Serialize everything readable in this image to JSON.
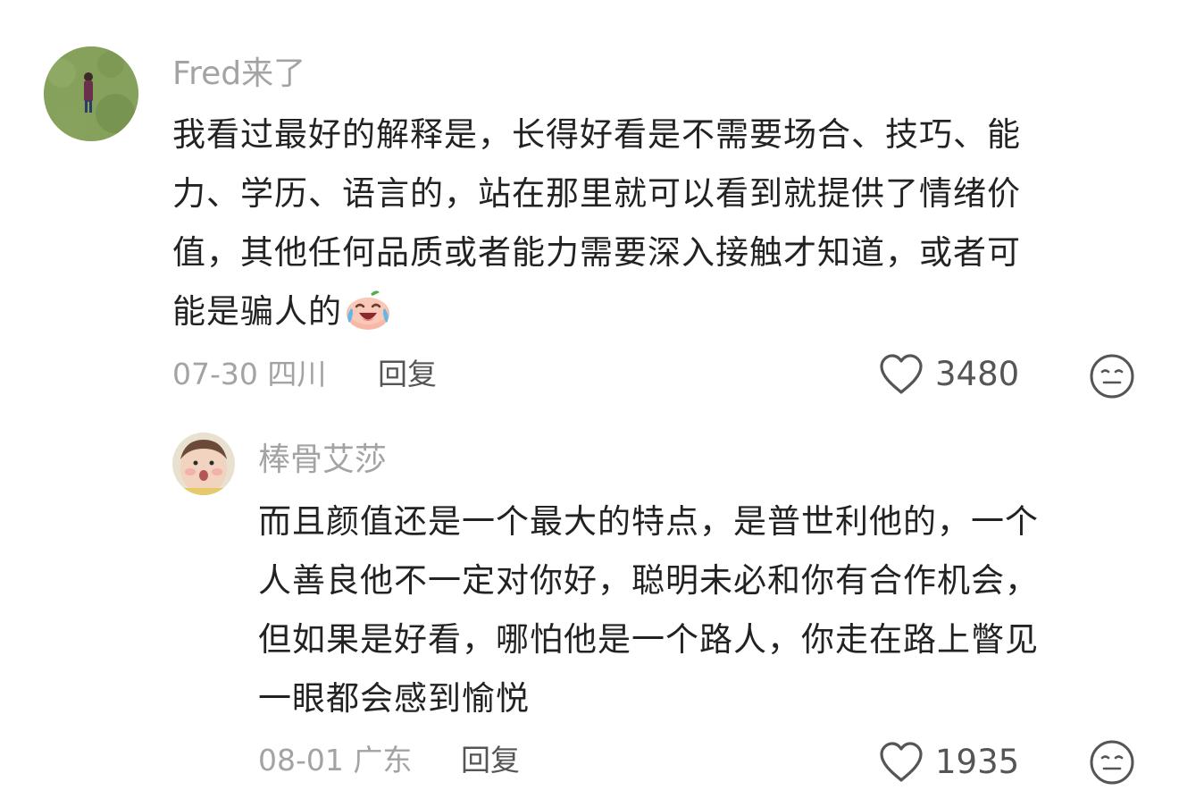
{
  "comments": [
    {
      "username": "Fred来了",
      "avatar_icon": "avatar-grass-person",
      "lines": [
        "我看过最好的解释是，长得好看是不需要场合、技巧、能",
        "力、学历、语言的，站在那里就可以看到就提供了情绪价",
        "值，其他任何品质或者能力需要深入接触才知道，或者可",
        "能是骗人的"
      ],
      "emoji_icon": "laugh-cry-peach-emoji",
      "meta": "07-30 四川",
      "reply_label": "回复",
      "like_count": "3480",
      "like_icon": "heart-outline-icon",
      "dislike_icon": "meh-face-icon"
    },
    {
      "username": "棒骨艾莎",
      "avatar_icon": "avatar-baby",
      "lines": [
        "而且颜值还是一个最大的特点，是普世利他的，一个",
        "人善良他不一定对你好，聪明未必和你有合作机会，",
        "但如果是好看，哪怕他是一个路人，你走在路上瞥见",
        "一眼都会感到愉悦"
      ],
      "meta": "08-01 广东",
      "reply_label": "回复",
      "like_count": "1935",
      "like_icon": "heart-outline-icon",
      "dislike_icon": "meh-face-icon"
    }
  ],
  "colors": {
    "text": "#222222",
    "muted": "#a3a3a3",
    "action": "#555555"
  }
}
